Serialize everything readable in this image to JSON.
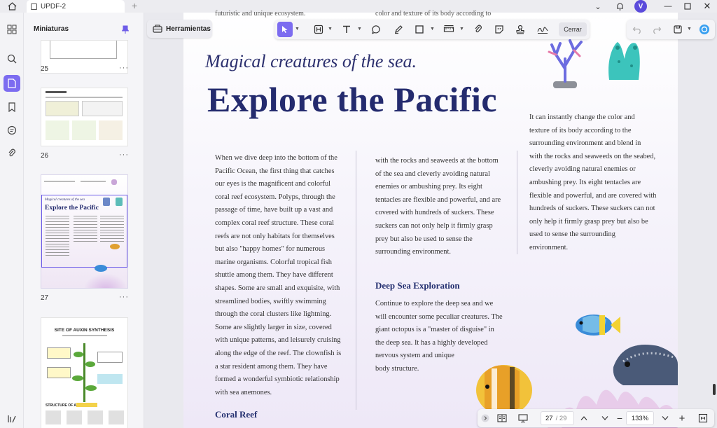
{
  "window": {
    "tab_title": "UPDF-2",
    "avatar_letter": "V"
  },
  "sidebar": {
    "panel_title": "Miniaturas",
    "thumbnails": [
      {
        "page": "25"
      },
      {
        "page": "26"
      },
      {
        "page": "27",
        "preview_subtitle": "Magical creatures of the sea",
        "preview_title": "Explore the Pacific"
      },
      {
        "page": "",
        "preview_title": "SITE OF AUXIN SYNTHESIS",
        "preview_footer": "STRUCTURE OF AUXIN"
      }
    ]
  },
  "toolbar": {
    "tools_label": "Herramientas",
    "close_label": "Cerrar"
  },
  "document": {
    "cutoff_left": "futuristic and unique ecosystem.",
    "cutoff_mid": "color and texture of its body according to",
    "subtitle": "Magical creatures of the sea.",
    "title": "Explore the Pacific",
    "col1_lines": [
      "When we dive deep into the bottom of the",
      "Pacific Ocean, the first thing that catches",
      "our eyes is the magnificent and colorful",
      "coral reef ecosystem. Polyps, through the",
      "passage of time, have built up a vast and",
      "complex coral reef structure. These coral",
      "reefs are not only habitats for themselves",
      "but also \"happy homes\" for numerous",
      "marine organisms. Colorful tropical fish",
      "shuttle among them. They have different",
      "shapes. Some are small and exquisite, with",
      "streamlined bodies, swiftly swimming",
      "through the coral clusters like lightning.",
      "Some are slightly larger in size, covered",
      "with unique patterns, and leisurely cruising",
      "along the edge of the reef. The clownfish is",
      "a star resident among them. They have",
      "formed a wonderful symbiotic relationship",
      "with sea anemones."
    ],
    "coral_heading": "Coral Reef",
    "col2_lines": [
      "with the rocks and seaweeds at the bottom",
      "of the sea and cleverly avoiding natural",
      "enemies or ambushing prey. Its eight",
      "tentacles are flexible and powerful, and are",
      "covered with hundreds of suckers. These",
      "suckers can not only help it firmly grasp",
      "prey but also be used to sense the",
      "surrounding environment."
    ],
    "deep_heading": "Deep Sea Exploration",
    "col2b_lines": [
      "Continue to explore the deep sea and we",
      "will encounter some peculiar creatures. The",
      "giant octopus is a \"master of disguise\" in",
      "the deep sea. It has a highly developed",
      "nervous system and unique",
      "body structure."
    ],
    "col3_lines": [
      "It can instantly change the color and",
      "texture of its body according to the",
      "surrounding environment and blend in",
      "with the rocks and seaweeds on the seabed,",
      "cleverly avoiding natural enemies or",
      "ambushing prey. Its eight tentacles are",
      "flexible and powerful, and are covered with",
      "hundreds of suckers. These suckers can not",
      "only help it firmly grasp prey but also be",
      "used to sense the surrounding",
      "environment."
    ]
  },
  "bottom_nav": {
    "current_page": "27",
    "total_pages": "/ 29",
    "zoom": "133%"
  },
  "colors": {
    "accent": "#7c6cf0",
    "title": "#242b6e"
  }
}
